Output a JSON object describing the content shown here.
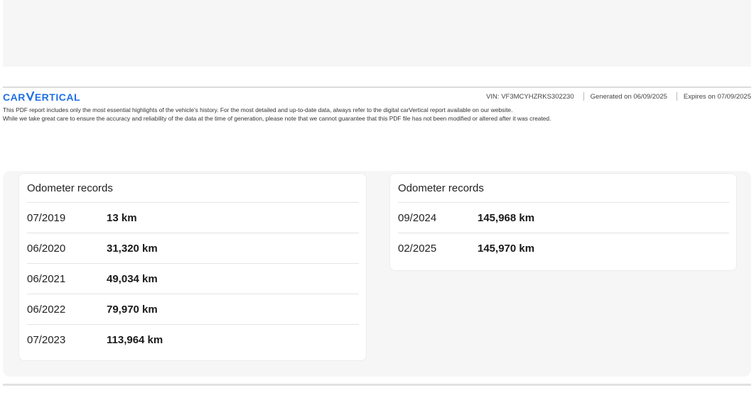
{
  "header": {
    "logo_text_left": "CAR",
    "logo_text_right": "ERTICAL",
    "vin": "VIN: VF3MCYHZRKS302230",
    "generated": "Generated on 06/09/2025",
    "expires": "Expires on 07/09/2025",
    "brand_color": "#1f6fe5"
  },
  "disclaimer": {
    "line1": "This PDF report includes only the most essential highlights of the vehicle's history. For the most detailed and up-to-date data, always refer to the digital carVertical report available on our website.",
    "line2": "While we take great care to ensure the accuracy and reliability of the data at the time of generation, please note that we cannot guarantee that this PDF file has not been modified or altered after it was created."
  },
  "odometer_left": {
    "title": "Odometer records",
    "records": [
      {
        "date": "07/2019",
        "km": "13 km"
      },
      {
        "date": "06/2020",
        "km": "31,320 km"
      },
      {
        "date": "06/2021",
        "km": "49,034 km"
      },
      {
        "date": "06/2022",
        "km": "79,970 km"
      },
      {
        "date": "07/2023",
        "km": "113,964 km"
      }
    ]
  },
  "odometer_right": {
    "title": "Odometer records",
    "records": [
      {
        "date": "09/2024",
        "km": "145,968 km"
      },
      {
        "date": "02/2025",
        "km": "145,970 km"
      }
    ]
  }
}
